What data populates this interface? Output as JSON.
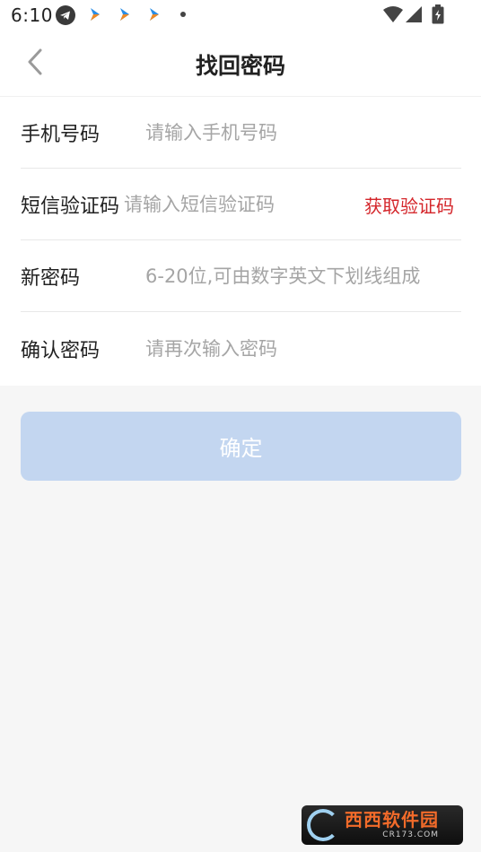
{
  "status_bar": {
    "time": "6:10",
    "icons": [
      "telegram-icon",
      "app-icon",
      "app-icon",
      "app-icon",
      "dot-icon",
      "wifi-icon",
      "signal-icon",
      "battery-icon"
    ]
  },
  "nav": {
    "title": "找回密码",
    "back_icon": "chevron-left-icon"
  },
  "form": {
    "phone": {
      "label": "手机号码",
      "placeholder": "请输入手机号码",
      "value": ""
    },
    "sms_code": {
      "label": "短信验证码",
      "placeholder": "请输入短信验证码",
      "value": "",
      "get_code_label": "获取验证码"
    },
    "new_password": {
      "label": "新密码",
      "placeholder": "6-20位,可由数字英文下划线组成",
      "value": ""
    },
    "confirm_password": {
      "label": "确认密码",
      "placeholder": "请再次输入密码",
      "value": ""
    }
  },
  "confirm_button": {
    "label": "确定"
  },
  "watermark": {
    "main": "西西软件园",
    "sub": "CR173.COM"
  },
  "colors": {
    "accent_red": "#d4252a",
    "button_disabled": "#c3d6f0",
    "background": "#f6f6f6"
  }
}
